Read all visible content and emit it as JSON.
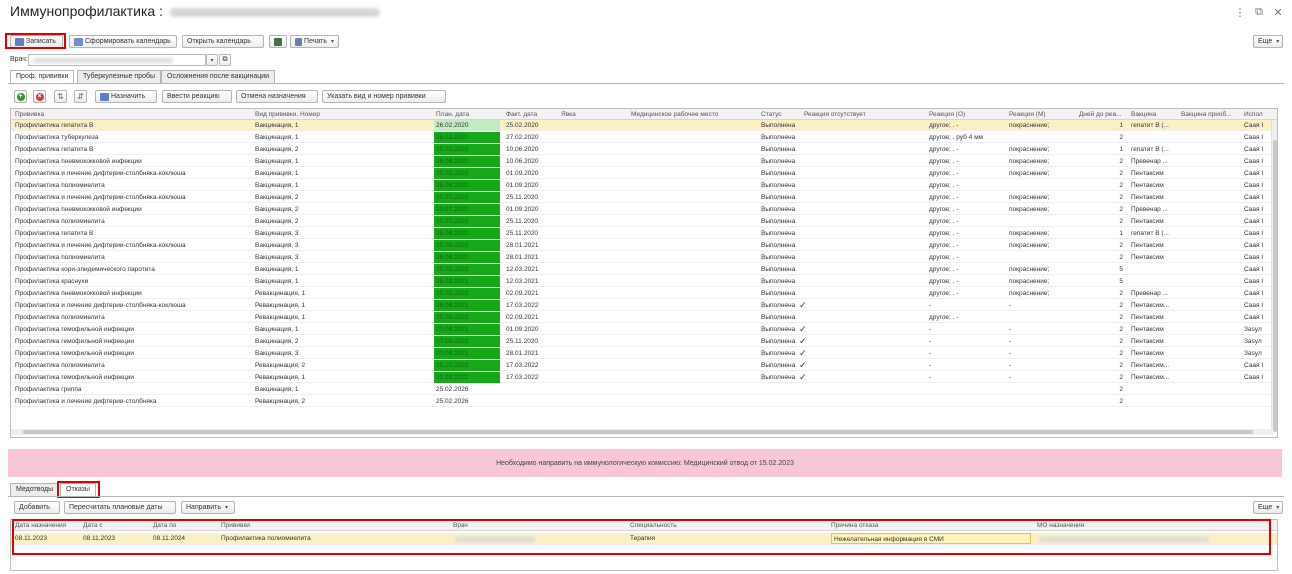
{
  "window": {
    "title": "Иммунопрофилактика :",
    "patient_name": "",
    "menu_icon": "more-vertical-icon",
    "restore_icon": "restore-window-icon",
    "close_icon": "close-icon"
  },
  "toolbar": {
    "save_label": "Записать",
    "make_calendar_label": "Сформировать календарь",
    "open_calendar_label": "Открыть календарь",
    "print_label": "Печать",
    "more_label": "Еще"
  },
  "doctor": {
    "label": "Врач:",
    "value": ""
  },
  "tabs": [
    {
      "label": "Проф. прививки",
      "active": true
    },
    {
      "label": "Туберкулезные пробы",
      "active": false
    },
    {
      "label": "Осложнения после вакцинации",
      "active": false
    }
  ],
  "vacc_toolbar": {
    "assign_label": "Назначить",
    "enter_reaction_label": "Ввести реакцию",
    "cancel_assignment_label": "Отмена назначения",
    "specify_vaccine_label": "Указать вид и номер прививки"
  },
  "vacc_table": {
    "columns": [
      "Прививка",
      "Вид прививки, Номер",
      "План. дата",
      "Факт. дата",
      "Явка",
      "Медицинское рабочее место",
      "Статус",
      "Реакция отсутствует",
      "Реакция (О)",
      "Реакция (М)",
      "Дней до реа...",
      "Вакцина",
      "Вакцина приоб...",
      "Испол"
    ],
    "rows": [
      {
        "name": "Профилактика гепатита В",
        "kind": "Вакцинация, 1",
        "plan": "26.02.2020",
        "plan_bg": "light",
        "fact": "25.02.2020",
        "status": "Выполнена",
        "no_reaction": false,
        "react_o": "другое; . -",
        "react_m": "покраснение;",
        "days": "1",
        "vaccine": "гепатит В (...",
        "used": "Саая I",
        "selected": true
      },
      {
        "name": "Профилактика туберкулеза",
        "kind": "Вакцинация, 1",
        "plan": "28.02.2020",
        "plan_bg": "green",
        "fact": "27.02.2020",
        "status": "Выполнена",
        "no_reaction": false,
        "react_o": "другое; . руб 4 мм",
        "react_m": "",
        "days": "2",
        "vaccine": "",
        "used": "Саая I",
        "selected": false
      },
      {
        "name": "Профилактика гепатита В",
        "kind": "Вакцинация, 2",
        "plan": "25.03.2020",
        "plan_bg": "green",
        "fact": "10.06.2020",
        "status": "Выполнена",
        "no_reaction": false,
        "react_o": "другое; . -",
        "react_m": "покраснение;",
        "days": "1",
        "vaccine": "гепатит В (...",
        "used": "Саая I",
        "selected": false
      },
      {
        "name": "Профилактика пневмококковой инфекции",
        "kind": "Вакцинация, 1",
        "plan": "25.04.2020",
        "plan_bg": "green",
        "fact": "10.06.2020",
        "status": "Выполнена",
        "no_reaction": false,
        "react_o": "другое; . -",
        "react_m": "покраснение;",
        "days": "2",
        "vaccine": "Превенар ...",
        "used": "Саая I",
        "selected": false
      },
      {
        "name": "Профилактика и лечение дифтерии-столбняка-коклюша",
        "kind": "Вакцинация, 1",
        "plan": "25.05.2020",
        "plan_bg": "green",
        "fact": "01.09.2020",
        "status": "Выполнена",
        "no_reaction": false,
        "react_o": "другое; . -",
        "react_m": "покраснение;",
        "days": "2",
        "vaccine": "Пентаксим",
        "used": "Саая I",
        "selected": false
      },
      {
        "name": "Профилактика полиомиелита",
        "kind": "Вакцинация, 1",
        "plan": "25.05.2020",
        "plan_bg": "green",
        "fact": "01.09.2020",
        "status": "Выполнена",
        "no_reaction": false,
        "react_o": "другое; . -",
        "react_m": "",
        "days": "2",
        "vaccine": "Пентаксим",
        "used": "Саая I",
        "selected": false
      },
      {
        "name": "Профилактика и лечение дифтерии-столбняка-коклюша",
        "kind": "Вакцинация, 2",
        "plan": "10.07.2020",
        "plan_bg": "green",
        "fact": "25.11.2020",
        "status": "Выполнена",
        "no_reaction": false,
        "react_o": "другое; . -",
        "react_m": "покраснение;",
        "days": "2",
        "vaccine": "Пентаксим",
        "used": "Саая I",
        "selected": false
      },
      {
        "name": "Профилактика пневмококковой инфекции",
        "kind": "Вакцинация, 2",
        "plan": "10.07.2020",
        "plan_bg": "green",
        "fact": "01.09.2020",
        "status": "Выполнена",
        "no_reaction": false,
        "react_o": "другое; . -",
        "react_m": "покраснение;",
        "days": "2",
        "vaccine": "Превенар ...",
        "used": "Саая I",
        "selected": false
      },
      {
        "name": "Профилактика полиомиелита",
        "kind": "Вакцинация, 2",
        "plan": "10.07.2020",
        "plan_bg": "green",
        "fact": "25.11.2020",
        "status": "Выполнена",
        "no_reaction": false,
        "react_o": "другое; . -",
        "react_m": "",
        "days": "2",
        "vaccine": "Пентаксим",
        "used": "Саая I",
        "selected": false
      },
      {
        "name": "Профилактика гепатита В",
        "kind": "Вакцинация, 3",
        "plan": "25.08.2020",
        "plan_bg": "green",
        "fact": "25.11.2020",
        "status": "Выполнена",
        "no_reaction": false,
        "react_o": "другое; . -",
        "react_m": "покраснение;",
        "days": "1",
        "vaccine": "гепатит В (...",
        "used": "Саая I",
        "selected": false
      },
      {
        "name": "Профилактика и лечение дифтерии-столбняка-коклюша",
        "kind": "Вакцинация, 3",
        "plan": "25.08.2020",
        "plan_bg": "green",
        "fact": "28.01.2021",
        "status": "Выполнена",
        "no_reaction": false,
        "react_o": "другое; . -",
        "react_m": "покраснение;",
        "days": "2",
        "vaccine": "Пентаксим",
        "used": "Саая I",
        "selected": false
      },
      {
        "name": "Профилактика полиомиелита",
        "kind": "Вакцинация, 3",
        "plan": "25.08.2020",
        "plan_bg": "green",
        "fact": "28.01.2021",
        "status": "Выполнена",
        "no_reaction": false,
        "react_o": "другое; . -",
        "react_m": "",
        "days": "2",
        "vaccine": "Пентаксим",
        "used": "Саая I",
        "selected": false
      },
      {
        "name": "Профилактика кори-эпидемического паротита",
        "kind": "Вакцинация, 1",
        "plan": "25.02.2021",
        "plan_bg": "green",
        "fact": "12.03.2021",
        "status": "Выполнена",
        "no_reaction": false,
        "react_o": "другое; . -",
        "react_m": "покраснение;",
        "days": "5",
        "vaccine": "",
        "used": "Саая I",
        "selected": false
      },
      {
        "name": "Профилактика краснухи",
        "kind": "Вакцинация, 1",
        "plan": "25.02.2021",
        "plan_bg": "green",
        "fact": "12.03.2021",
        "status": "Выполнена",
        "no_reaction": false,
        "react_o": "другое; . -",
        "react_m": "покраснение;",
        "days": "5",
        "vaccine": "",
        "used": "Саая I",
        "selected": false
      },
      {
        "name": "Профилактика пневмококковой инфекции",
        "kind": "Ревакцинация, 1",
        "plan": "25.05.2021",
        "plan_bg": "green",
        "fact": "02.09.2021",
        "status": "Выполнена",
        "no_reaction": false,
        "react_o": "другое; . -",
        "react_m": "покраснение;",
        "days": "2",
        "vaccine": "Превенар ...",
        "used": "Саая I",
        "selected": false
      },
      {
        "name": "Профилактика и лечение дифтерии-столбняка-коклюша",
        "kind": "Ревакцинация, 1",
        "plan": "25.08.2021",
        "plan_bg": "green",
        "fact": "17.03.2022",
        "status": "Выполнена",
        "no_reaction": true,
        "react_o": "-",
        "react_m": "-",
        "days": "2",
        "vaccine": "Пентаксим...",
        "used": "Саая I",
        "selected": false
      },
      {
        "name": "Профилактика полиомиелита",
        "kind": "Ревакцинация, 1",
        "plan": "25.08.2021",
        "plan_bg": "green",
        "fact": "02.09.2021",
        "status": "Выполнена",
        "no_reaction": false,
        "react_o": "другое; . -",
        "react_m": "",
        "days": "2",
        "vaccine": "Пентаксим",
        "used": "Саая I",
        "selected": false
      },
      {
        "name": "Профилактика гемофильной инфекции",
        "kind": "Вакцинация, 1",
        "plan": "07.09.2021",
        "plan_bg": "green",
        "fact": "01.09.2020",
        "status": "Выполнена",
        "no_reaction": true,
        "react_o": "-",
        "react_m": "-",
        "days": "2",
        "vaccine": "Пентаксим",
        "used": "Заsyл",
        "selected": false
      },
      {
        "name": "Профилактика гемофильной инфекции",
        "kind": "Вакцинация, 2",
        "plan": "07.09.2021",
        "plan_bg": "green",
        "fact": "25.11.2020",
        "status": "Выполнена",
        "no_reaction": true,
        "react_o": "-",
        "react_m": "-",
        "days": "2",
        "vaccine": "Пентаксим",
        "used": "Заsyл",
        "selected": false
      },
      {
        "name": "Профилактика гемофильной инфекции",
        "kind": "Вакцинация, 3",
        "plan": "07.09.2021",
        "plan_bg": "green",
        "fact": "28.01.2021",
        "status": "Выполнена",
        "no_reaction": true,
        "react_o": "-",
        "react_m": "-",
        "days": "2",
        "vaccine": "Пентаксим",
        "used": "Заsyл",
        "selected": false
      },
      {
        "name": "Профилактика полиомиелита",
        "kind": "Ревакцинация, 2",
        "plan": "25.10.2021",
        "plan_bg": "green",
        "fact": "17.03.2022",
        "status": "Выполнена",
        "no_reaction": true,
        "react_o": "-",
        "react_m": "-",
        "days": "2",
        "vaccine": "Пентаксим...",
        "used": "Саая I",
        "selected": false
      },
      {
        "name": "Профилактика гемофильной инфекции",
        "kind": "Ревакцинация, 1",
        "plan": "21.03.2022",
        "plan_bg": "green",
        "fact": "17.03.2022",
        "status": "Выполнена",
        "no_reaction": true,
        "react_o": "-",
        "react_m": "-",
        "days": "2",
        "vaccine": "Пентаксим...",
        "used": "Саая I",
        "selected": false
      },
      {
        "name": "Профилактика гриппа",
        "kind": "Вакцинация, 1",
        "plan": "25.02.2026",
        "plan_bg": "none",
        "fact": "",
        "status": "",
        "no_reaction": false,
        "react_o": "",
        "react_m": "",
        "days": "2",
        "vaccine": "",
        "used": "",
        "selected": false
      },
      {
        "name": "Профилактика и лечение дифтерии-столбняка",
        "kind": "Ревакцинация, 2",
        "plan": "25.02.2026",
        "plan_bg": "none",
        "fact": "",
        "status": "",
        "no_reaction": false,
        "react_o": "",
        "react_m": "",
        "days": "2",
        "vaccine": "",
        "used": "",
        "selected": false
      }
    ]
  },
  "warning": {
    "text": "Необходимо направить на иммунологическую комиссию: Медицинский отвод от 15.02.2023"
  },
  "lower_tabs": [
    {
      "label": "Медотводы",
      "active": false
    },
    {
      "label": "Отказы",
      "active": true
    }
  ],
  "lower_toolbar": {
    "add_label": "Добавить",
    "recalc_label": "Пересчитать плановые даты",
    "send_label": "Направить",
    "more_label": "Еще"
  },
  "refusals_table": {
    "columns": [
      "Дата назначения",
      "Дата с",
      "Дата по",
      "Прививки",
      "Врач",
      "Специальность",
      "Причина отказа",
      "МО назначения"
    ],
    "rows": [
      {
        "assigned": "08.11.2023",
        "from": "08.11.2023",
        "to": "08.11.2024",
        "vaccine": "Профилактика полиомиелита",
        "doctor": "",
        "specialty": "Терапия",
        "reason": "Нежелательная информация в СМИ",
        "mo": ""
      }
    ]
  },
  "colors": {
    "plan_green": "#17a81a",
    "plan_light": "#c4ecc4",
    "selected_row": "#fbf0c4",
    "warning_bg": "#f7c8d3",
    "highlight": "#e00000"
  }
}
